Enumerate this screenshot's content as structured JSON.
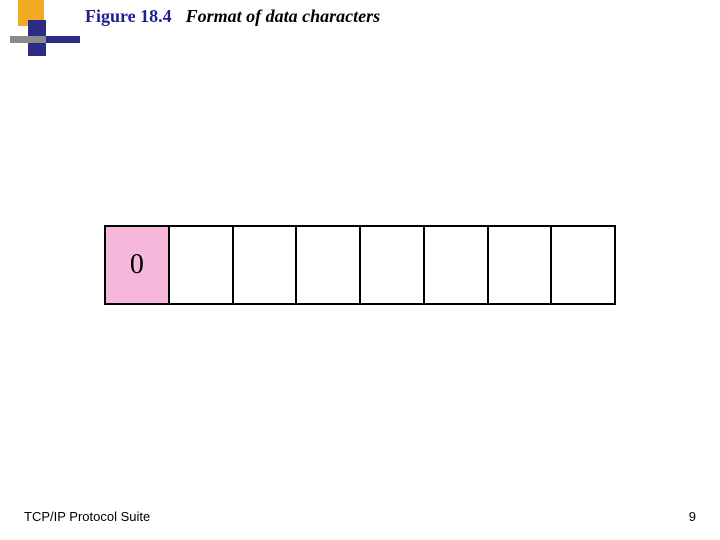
{
  "header": {
    "figure_number": "Figure 18.4",
    "figure_title": "Format of data characters"
  },
  "diagram": {
    "cells": [
      "0",
      "",
      "",
      "",
      "",
      "",
      "",
      ""
    ],
    "highlight_index": 0
  },
  "footer": {
    "left": "TCP/IP Protocol Suite",
    "page_number": "9"
  },
  "colors": {
    "title_blue": "#1f1f8f",
    "highlight_pink": "#f5b8db",
    "accent_orange": "#f2a924",
    "accent_navy": "#2c2c85"
  }
}
